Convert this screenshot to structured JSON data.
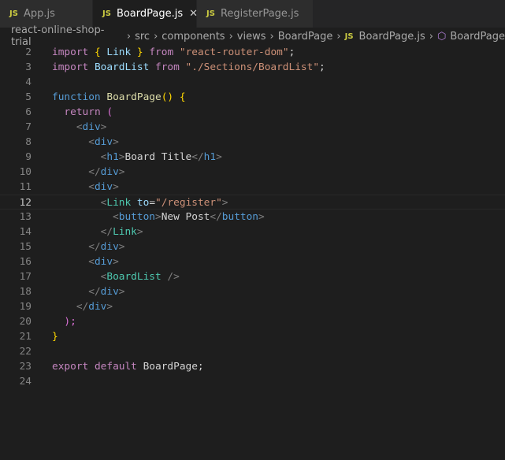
{
  "tabs": [
    {
      "label": "App.js",
      "icon": "js-icon",
      "active": false
    },
    {
      "label": "BoardPage.js",
      "icon": "js-icon",
      "active": true
    },
    {
      "label": "RegisterPage.js",
      "icon": "js-icon",
      "active": false
    }
  ],
  "tab_icon_text": "JS",
  "breadcrumb": [
    "react-online-shop-trial",
    "src",
    "components",
    "views",
    "BoardPage",
    "BoardPage.js",
    "BoardPage"
  ],
  "current_line": 12,
  "lines": [
    {
      "n": 2,
      "t": [
        [
          "import",
          "kw"
        ],
        [
          " ",
          "txt"
        ],
        [
          "{",
          "b1"
        ],
        [
          " Link ",
          "var"
        ],
        [
          "}",
          "b1"
        ],
        [
          " ",
          "txt"
        ],
        [
          "from",
          "kw"
        ],
        [
          " ",
          "txt"
        ],
        [
          "\"react-router-dom\"",
          "str"
        ],
        [
          ";",
          "txt"
        ]
      ]
    },
    {
      "n": 3,
      "t": [
        [
          "import",
          "kw"
        ],
        [
          " BoardList ",
          "var"
        ],
        [
          "from",
          "kw"
        ],
        [
          " ",
          "txt"
        ],
        [
          "\"./Sections/BoardList\"",
          "str"
        ],
        [
          ";",
          "txt"
        ]
      ]
    },
    {
      "n": 4,
      "t": []
    },
    {
      "n": 5,
      "t": [
        [
          "function",
          "st"
        ],
        [
          " ",
          "txt"
        ],
        [
          "BoardPage",
          "fn"
        ],
        [
          "()",
          "b1"
        ],
        [
          " ",
          "txt"
        ],
        [
          "{",
          "b1"
        ]
      ]
    },
    {
      "n": 6,
      "t": [
        [
          "  ",
          "txt"
        ],
        [
          "return",
          "kw"
        ],
        [
          " ",
          "txt"
        ],
        [
          "(",
          "b2"
        ]
      ]
    },
    {
      "n": 7,
      "t": [
        [
          "    ",
          "txt"
        ],
        [
          "<",
          "pun"
        ],
        [
          "div",
          "tag"
        ],
        [
          ">",
          "pun"
        ]
      ]
    },
    {
      "n": 8,
      "t": [
        [
          "      ",
          "txt"
        ],
        [
          "<",
          "pun"
        ],
        [
          "div",
          "tag"
        ],
        [
          ">",
          "pun"
        ]
      ]
    },
    {
      "n": 9,
      "t": [
        [
          "        ",
          "txt"
        ],
        [
          "<",
          "pun"
        ],
        [
          "h1",
          "tag"
        ],
        [
          ">",
          "pun"
        ],
        [
          "Board Title",
          "txt"
        ],
        [
          "</",
          "pun"
        ],
        [
          "h1",
          "tag"
        ],
        [
          ">",
          "pun"
        ]
      ]
    },
    {
      "n": 10,
      "t": [
        [
          "      ",
          "txt"
        ],
        [
          "</",
          "pun"
        ],
        [
          "div",
          "tag"
        ],
        [
          ">",
          "pun"
        ]
      ]
    },
    {
      "n": 11,
      "t": [
        [
          "      ",
          "txt"
        ],
        [
          "<",
          "pun"
        ],
        [
          "div",
          "tag"
        ],
        [
          ">",
          "pun"
        ]
      ]
    },
    {
      "n": 12,
      "t": [
        [
          "        ",
          "txt"
        ],
        [
          "<",
          "pun"
        ],
        [
          "Link",
          "comp"
        ],
        [
          " ",
          "txt"
        ],
        [
          "to",
          "var"
        ],
        [
          "=",
          "txt"
        ],
        [
          "\"/register\"",
          "str"
        ],
        [
          ">",
          "pun"
        ]
      ]
    },
    {
      "n": 13,
      "t": [
        [
          "          ",
          "txt"
        ],
        [
          "<",
          "pun"
        ],
        [
          "button",
          "tag"
        ],
        [
          ">",
          "pun"
        ],
        [
          "New Post",
          "txt"
        ],
        [
          "</",
          "pun"
        ],
        [
          "button",
          "tag"
        ],
        [
          ">",
          "pun"
        ]
      ]
    },
    {
      "n": 14,
      "t": [
        [
          "        ",
          "txt"
        ],
        [
          "</",
          "pun"
        ],
        [
          "Link",
          "comp"
        ],
        [
          ">",
          "pun"
        ]
      ]
    },
    {
      "n": 15,
      "t": [
        [
          "      ",
          "txt"
        ],
        [
          "</",
          "pun"
        ],
        [
          "div",
          "tag"
        ],
        [
          ">",
          "pun"
        ]
      ]
    },
    {
      "n": 16,
      "t": [
        [
          "      ",
          "txt"
        ],
        [
          "<",
          "pun"
        ],
        [
          "div",
          "tag"
        ],
        [
          ">",
          "pun"
        ]
      ]
    },
    {
      "n": 17,
      "t": [
        [
          "        ",
          "txt"
        ],
        [
          "<",
          "pun"
        ],
        [
          "BoardList",
          "comp"
        ],
        [
          " />",
          "pun"
        ]
      ]
    },
    {
      "n": 18,
      "t": [
        [
          "      ",
          "txt"
        ],
        [
          "</",
          "pun"
        ],
        [
          "div",
          "tag"
        ],
        [
          ">",
          "pun"
        ]
      ]
    },
    {
      "n": 19,
      "t": [
        [
          "    ",
          "txt"
        ],
        [
          "</",
          "pun"
        ],
        [
          "div",
          "tag"
        ],
        [
          ">",
          "pun"
        ]
      ]
    },
    {
      "n": 20,
      "t": [
        [
          "  ",
          "txt"
        ],
        [
          ");",
          "b2"
        ]
      ]
    },
    {
      "n": 21,
      "t": [
        [
          "}",
          "b1"
        ]
      ]
    },
    {
      "n": 22,
      "t": []
    },
    {
      "n": 23,
      "t": [
        [
          "export",
          "kw"
        ],
        [
          " ",
          "txt"
        ],
        [
          "default",
          "kw"
        ],
        [
          " BoardPage;",
          "txt"
        ]
      ]
    },
    {
      "n": 24,
      "t": []
    }
  ]
}
